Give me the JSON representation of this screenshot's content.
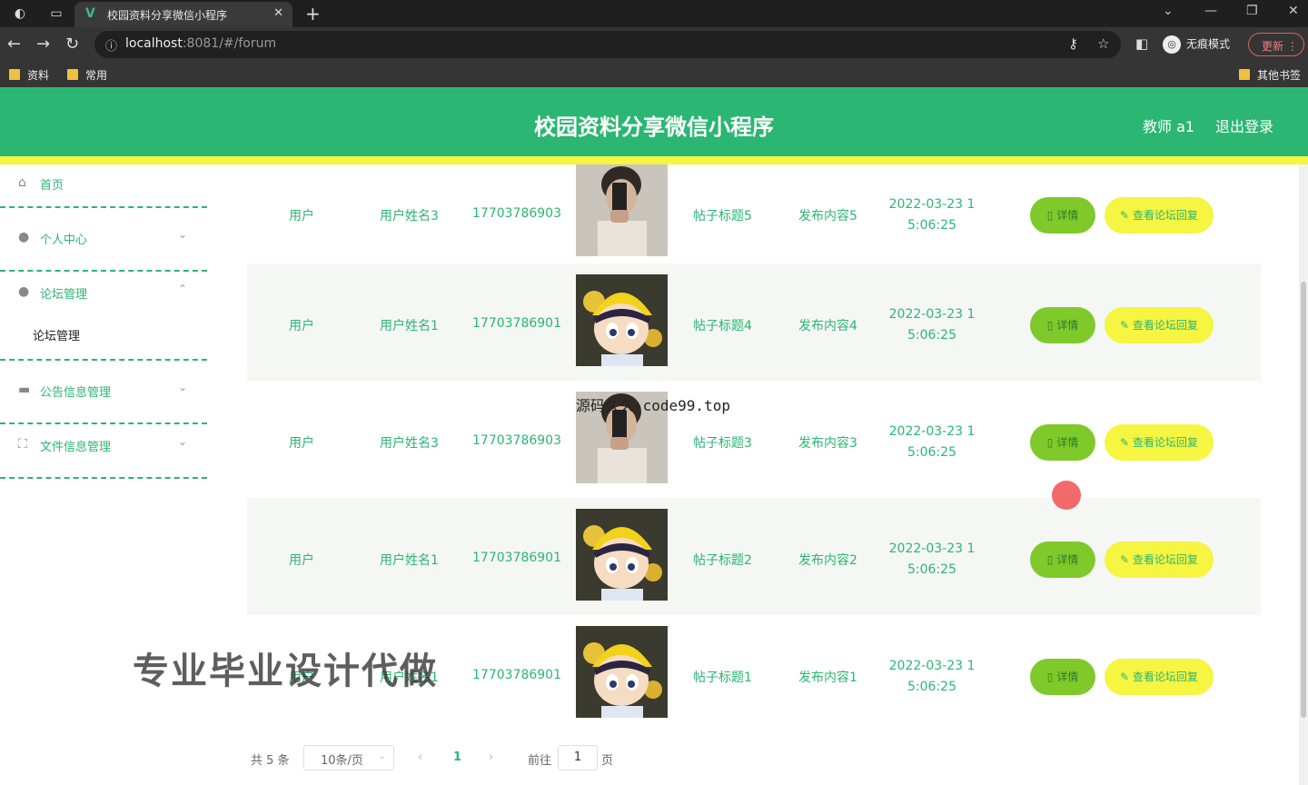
{
  "browser": {
    "tab_title": "校园资料分享微信小程序",
    "url_host": "localhost",
    "url_rest": ":8081/#/forum",
    "incognito_label": "无痕模式",
    "update_label": "更新",
    "bookmarks": [
      "资料",
      "常用"
    ],
    "other_bookmarks": "其他书签"
  },
  "header": {
    "title": "校园资料分享微信小程序",
    "user": "教师 a1",
    "logout": "退出登录"
  },
  "sidebar": {
    "items": [
      {
        "label": "首页",
        "icon": "home-icon"
      },
      {
        "label": "个人中心",
        "icon": "user-icon"
      },
      {
        "label": "论坛管理",
        "icon": "user-icon"
      },
      {
        "label": "论坛管理",
        "sub": true
      },
      {
        "label": "公告信息管理",
        "icon": "briefcase-icon"
      },
      {
        "label": "文件信息管理",
        "icon": "file-icon"
      }
    ]
  },
  "rows": [
    {
      "role": "用户",
      "name": "用户姓名3",
      "phone": "17703786903",
      "title": "帖子标题5",
      "content": "发布内容5",
      "time1": "2022-03-23 1",
      "time2": "5:06:25",
      "detail": "详情",
      "reply": "查看论坛回复",
      "avatar": "phone-selfie"
    },
    {
      "role": "用户",
      "name": "用户姓名1",
      "phone": "17703786901",
      "title": "帖子标题4",
      "content": "发布内容4",
      "time1": "2022-03-23 1",
      "time2": "5:06:25",
      "detail": "详情",
      "reply": "查看论坛回复",
      "avatar": "cartoon-boy"
    },
    {
      "role": "用户",
      "name": "用户姓名3",
      "phone": "17703786903",
      "title": "帖子标题3",
      "content": "发布内容3",
      "time1": "2022-03-23 1",
      "time2": "5:06:25",
      "detail": "详情",
      "reply": "查看论坛回复",
      "avatar": "phone-selfie"
    },
    {
      "role": "用户",
      "name": "用户姓名1",
      "phone": "17703786901",
      "title": "帖子标题2",
      "content": "发布内容2",
      "time1": "2022-03-23 1",
      "time2": "5:06:25",
      "detail": "详情",
      "reply": "查看论坛回复",
      "avatar": "cartoon-boy"
    },
    {
      "role": "用户",
      "name": "用户姓名1",
      "phone": "17703786901",
      "title": "帖子标题1",
      "content": "发布内容1",
      "time1": "2022-03-23 1",
      "time2": "5:06:25",
      "detail": "详情",
      "reply": "查看论坛回复",
      "avatar": "cartoon-boy"
    }
  ],
  "pagination": {
    "total": "共 5 条",
    "page_size": "10条/页",
    "current": "1",
    "goto": "前往",
    "goto_value": "1",
    "page_unit": "页"
  },
  "overlays": {
    "big_watermark": "专业毕业设计代做",
    "source_watermark": "源码久久-code99.top"
  },
  "colors": {
    "accent": "#2bb673",
    "yellow": "#f5f542",
    "lime": "#7fc92a"
  }
}
